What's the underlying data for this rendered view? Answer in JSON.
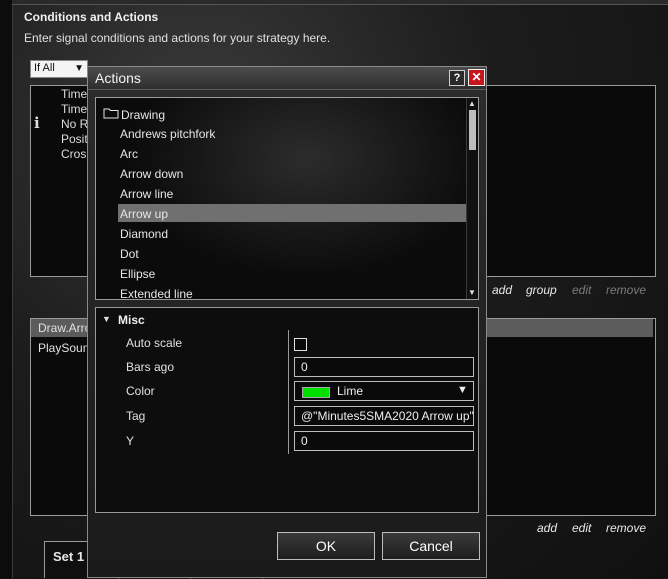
{
  "background": {
    "title": "Conditions and Actions",
    "subtitle": "Enter signal conditions and actions for your strategy here.",
    "condition_select": {
      "value": "If All"
    },
    "condition_items": [
      "Time",
      "Time",
      "No R",
      "Posit",
      "Cros"
    ],
    "condition_links": {
      "add": "add",
      "group": "group",
      "edit": "edit",
      "remove": "remove"
    },
    "action_items": [
      "Draw.Arro",
      "PlaySoun"
    ],
    "action_links": {
      "add": "add",
      "edit": "edit",
      "remove": "remove"
    },
    "tabs": [
      "Set 1"
    ]
  },
  "dialog": {
    "title": "Actions",
    "help_label": "?",
    "close_label": "✕",
    "folder": "Drawing",
    "items": [
      "Andrews pitchfork",
      "Arc",
      "Arrow down",
      "Arrow line",
      "Arrow up",
      "Diamond",
      "Dot",
      "Ellipse",
      "Extended line"
    ],
    "selected_item": "Arrow up",
    "group_label": "Misc",
    "properties": {
      "auto_scale": {
        "label": "Auto scale",
        "checked": false
      },
      "bars_ago": {
        "label": "Bars ago",
        "value": "0"
      },
      "color": {
        "label": "Color",
        "value": "Lime",
        "swatch": "#00e000"
      },
      "tag": {
        "label": "Tag",
        "value": "@\"Minutes5SMA2020 Arrow up\""
      },
      "y": {
        "label": "Y",
        "value": "0"
      }
    },
    "ok_label": "OK",
    "cancel_label": "Cancel"
  },
  "colors": {
    "accent_close": "#c4161c",
    "selection": "#707070"
  },
  "icons": [
    "folder-icon",
    "info-icon",
    "help-icon",
    "close-icon",
    "collapse-triangle-icon",
    "chevron-down-icon"
  ]
}
